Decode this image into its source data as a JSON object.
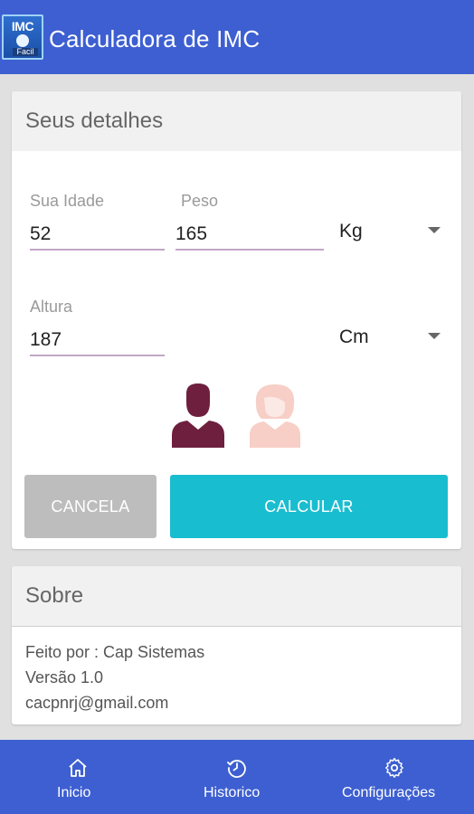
{
  "appbar": {
    "icon_text_top": "IMC",
    "icon_text_bottom": "Facil",
    "title": "Calculadora de IMC"
  },
  "details": {
    "header": "Seus detalhes",
    "age": {
      "label": "Sua Idade",
      "value": "52"
    },
    "weight": {
      "label": "Peso",
      "value": "165",
      "unit": "Kg"
    },
    "height": {
      "label": "Altura",
      "value": "187",
      "unit": "Cm"
    },
    "gender": {
      "male_icon": "male-avatar-icon",
      "female_icon": "female-avatar-icon",
      "selected": "male"
    },
    "cancel_label": "CANCELA",
    "calc_label": "CALCULAR"
  },
  "about": {
    "header": "Sobre",
    "made_by": "Feito por : Cap Sistemas",
    "version": "Versão 1.0",
    "email": "cacpnrj@gmail.com"
  },
  "nav": {
    "items": [
      {
        "label": "Inicio",
        "icon": "home-icon"
      },
      {
        "label": "Historico",
        "icon": "history-icon"
      },
      {
        "label": "Configurações",
        "icon": "gear-icon"
      }
    ]
  },
  "colors": {
    "primary": "#3d5fd1",
    "accent": "#19bdd0",
    "male": "#6e1f3d",
    "female": "#f7cfc7",
    "cancel": "#bdbdbd"
  }
}
